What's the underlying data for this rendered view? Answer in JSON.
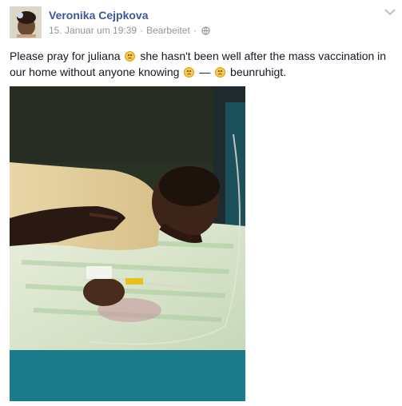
{
  "post": {
    "author": "Veronika Cejpkova",
    "timestamp": "15. Januar um 19:39",
    "separator": "·",
    "edited_label": "Bearbeitet",
    "separator2": "·",
    "privacy_icon": "globe-icon",
    "options_icon": "chevron-down-icon",
    "text_part1": "Please pray for juliana",
    "text_part2": "she hasn't been well after the mass vaccination in our home without anyone knowing",
    "text_part3": "—",
    "feeling": "beunruhigt.",
    "emoji_icon": "sad-face-emoji-icon",
    "photo_description_icon": "post-photo"
  },
  "colors": {
    "author_link": "#3b5998",
    "meta_text": "#90949c",
    "body_text": "#141823"
  }
}
